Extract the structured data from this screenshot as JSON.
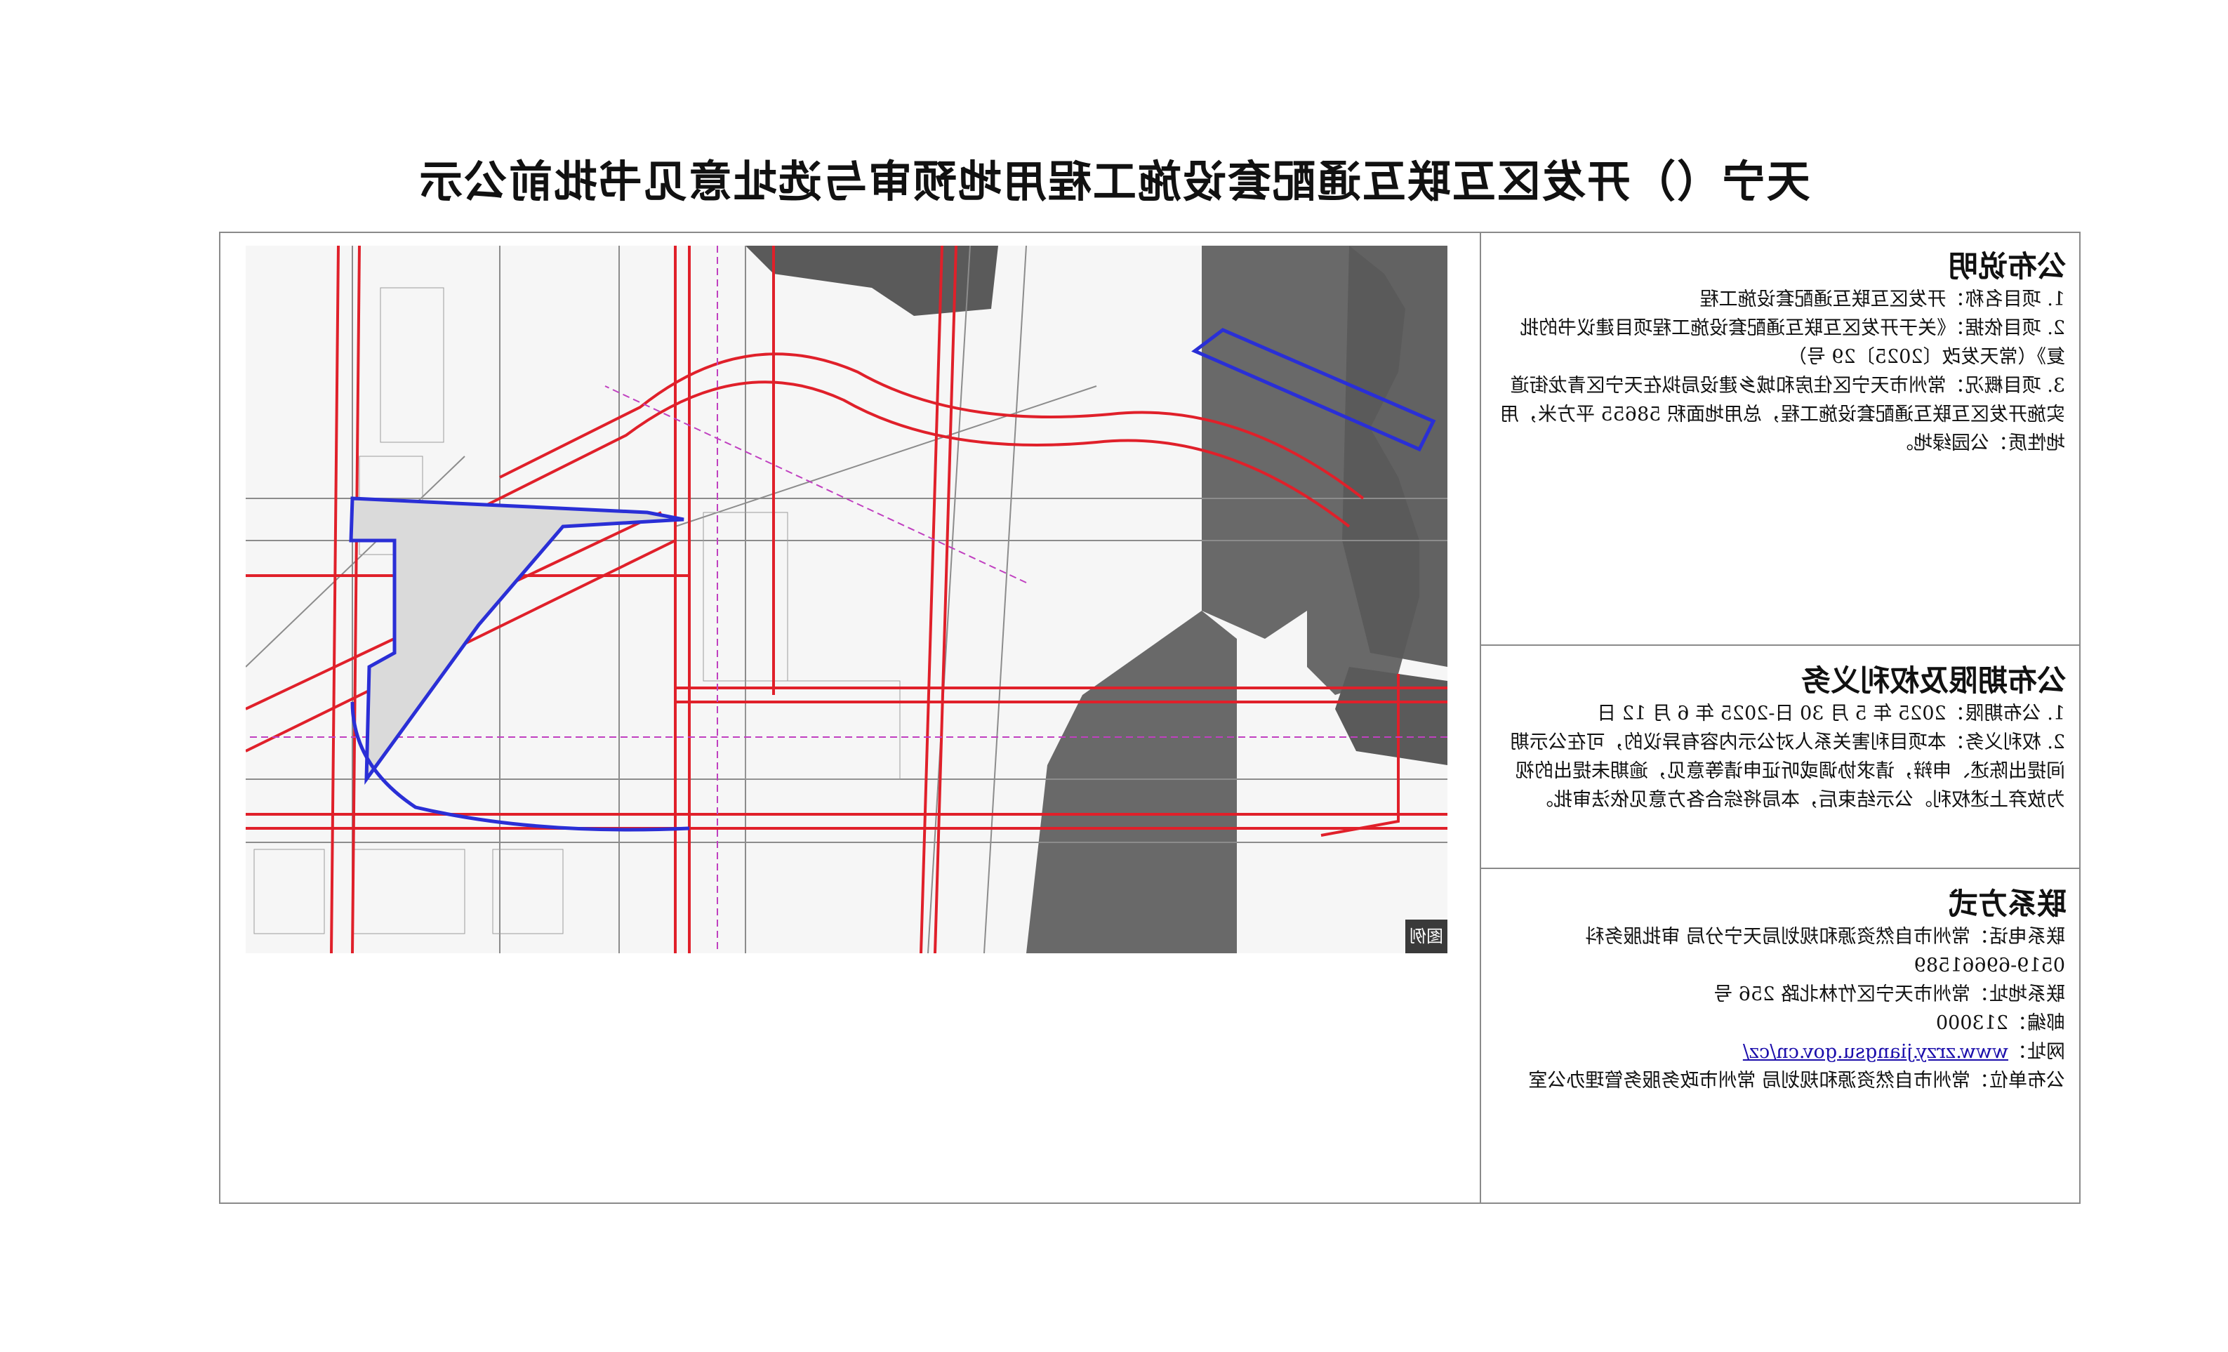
{
  "title": "天宁（）开发区互联互通配套设施工程用地预审与选址意见书批前公示",
  "sections": {
    "description": {
      "heading": "公布说明",
      "lines": [
        "1. 项目名称：开发区互联互通配套设施工程",
        "2. 项目依据：《关于开发区互联互通配套设施工程项目建议书的批",
        "复》（常天发改〔2025〕29 号）",
        "3. 项目概况：常州市天宁区住房和城乡建设局拟在天宁区青龙街道",
        "实施开发区互联互通配套设施工程，总用地面积 58655 平方米，用",
        "地性质：公园绿地。"
      ]
    },
    "period": {
      "heading": "公布期限及权利义务",
      "lines": [
        "1. 公布期限：2025 年 5 月 30 日-2025 年 6 月 12 日",
        "2. 权利义务：本项目利害关系人对公示内容有异议的，可在公示期",
        "间提出陈述、申辩，请求协调或听证申请等意见，逾期未提出的视",
        "为放弃上述权利。公示结束后，本局将综合各方意见依法审批。"
      ]
    },
    "contact": {
      "heading": "联系方式",
      "phone_label": "联系电话：常州市自然资源和规划局天宁分局  审批服务科",
      "phone_number": "0519-69661589",
      "address": "联系地址：常州市天宁区竹林北路 256 号",
      "postcode": "邮编：213000",
      "website_label": "网址：",
      "website_url": "www.zrzy.jiangsu.gov.cn/cz/",
      "publisher": "公布单位：常州市自然资源和规划局  常州市政务服务管理办公室"
    }
  },
  "map": {
    "legend_tab": "图例",
    "colors": {
      "road_red": "#e0202a",
      "site_blue": "#2a2fd6",
      "dark_area": "#5a5a5a",
      "base_line": "#8c8c8c",
      "magenta_line": "#c040c0"
    }
  }
}
